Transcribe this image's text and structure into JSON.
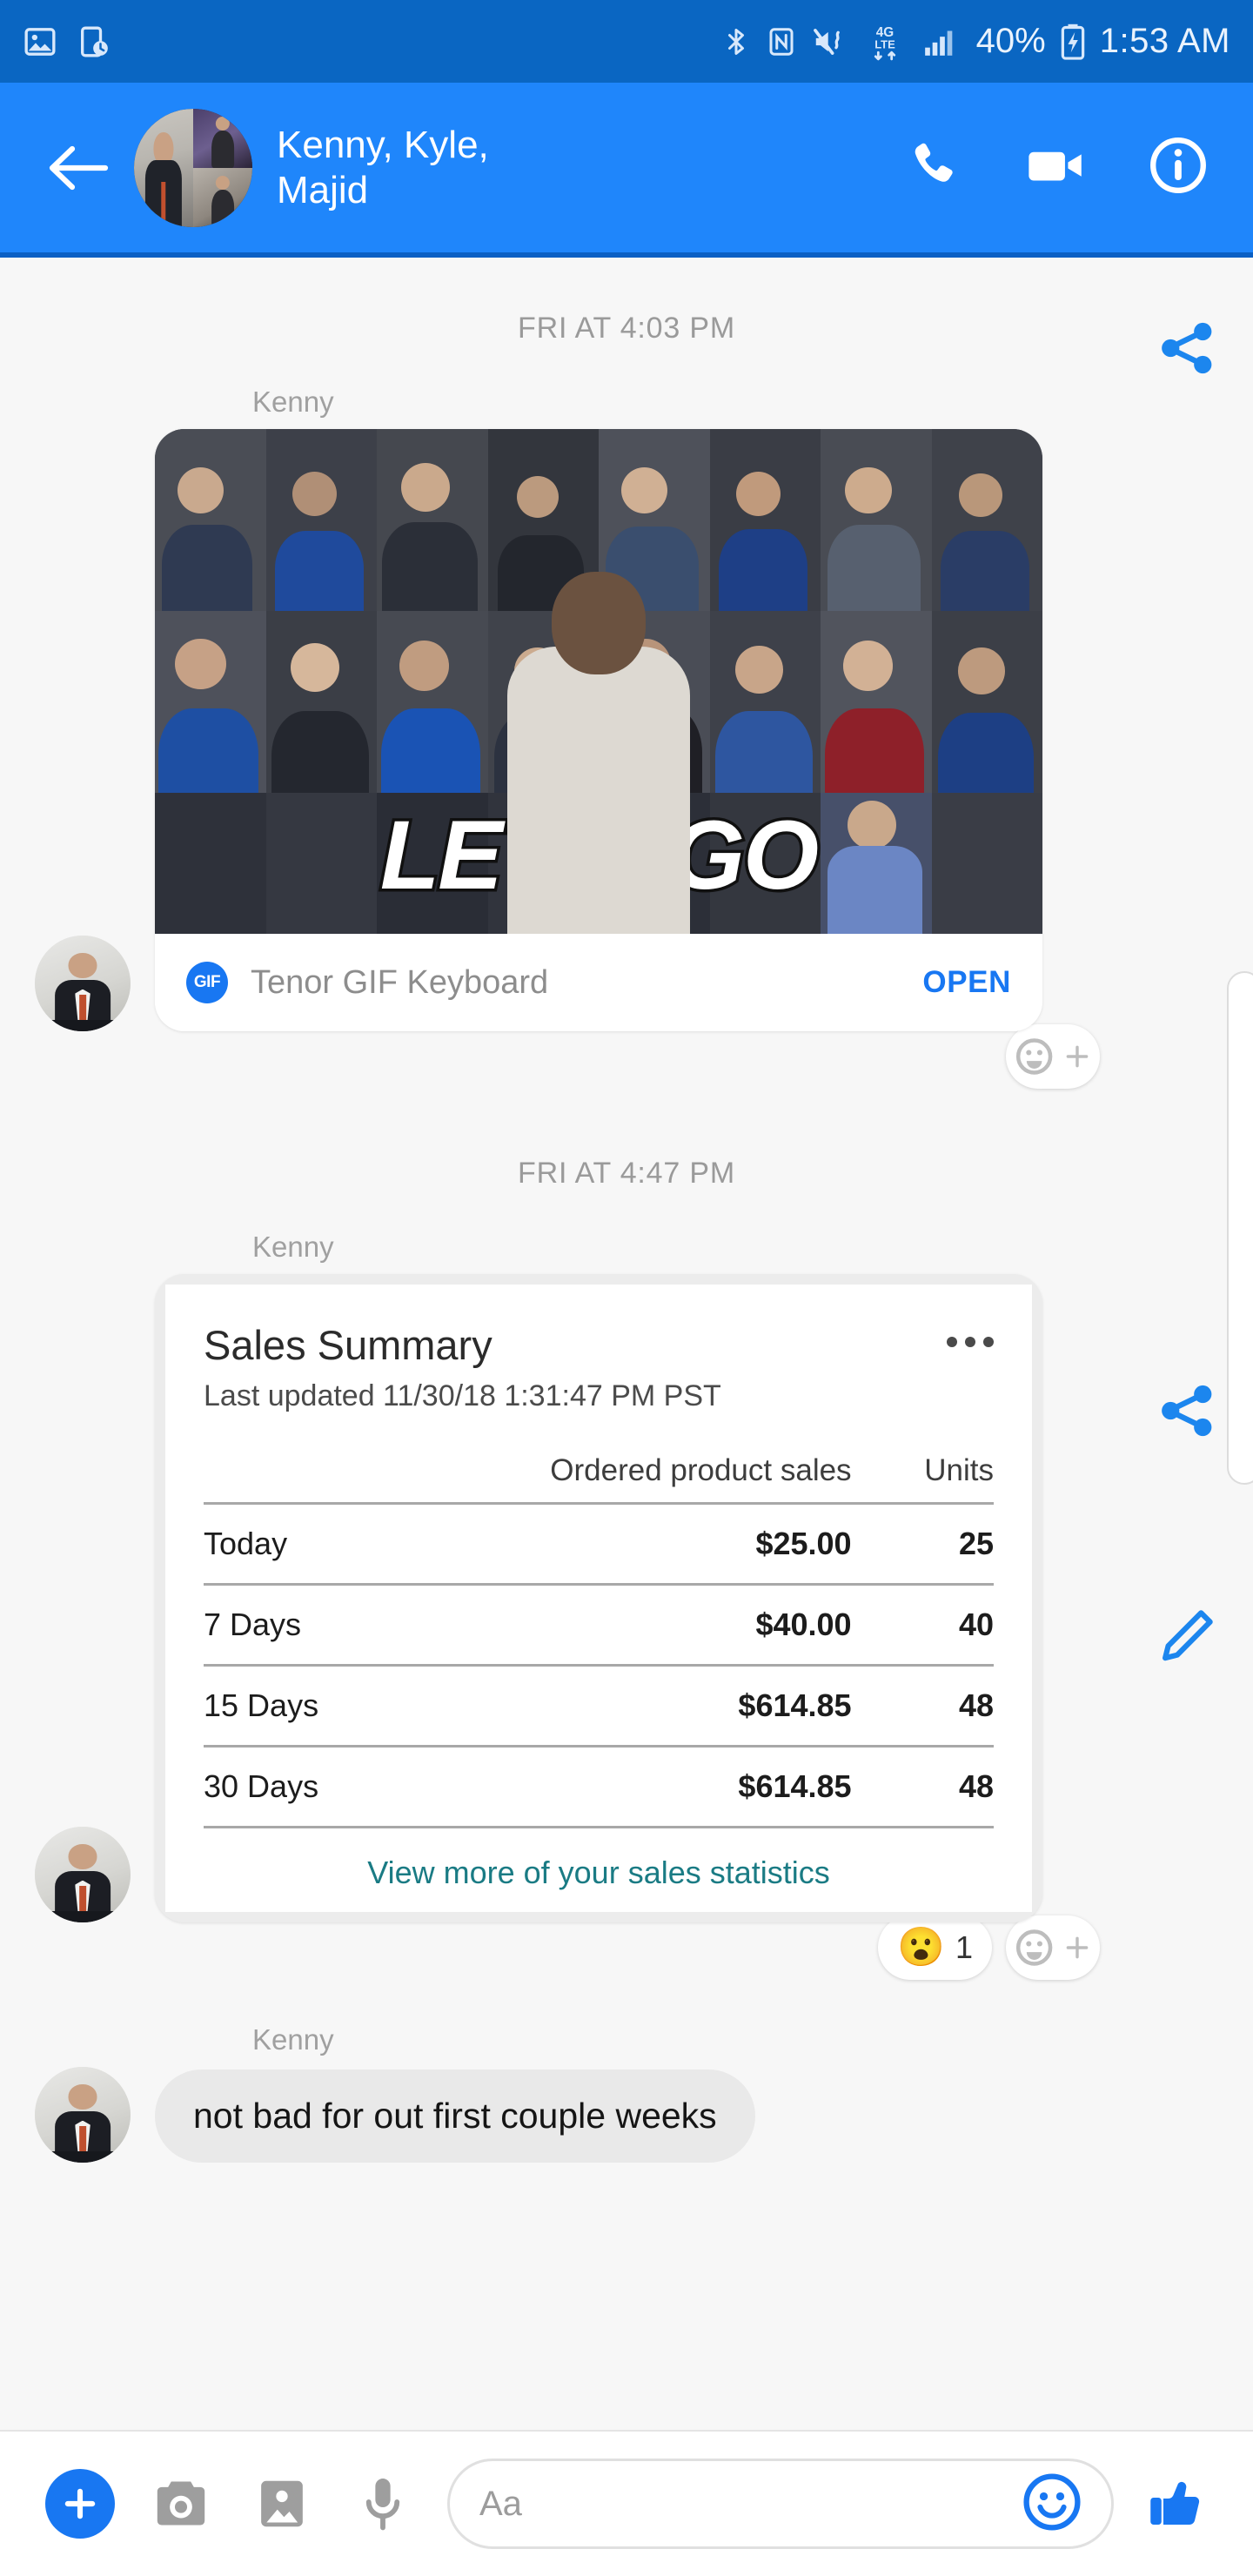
{
  "status_bar": {
    "left_icons": [
      "photo-icon",
      "screenshot-clock-icon"
    ],
    "right_icons": [
      "bluetooth-icon",
      "nfc-icon",
      "mute-vibrate-icon",
      "4g-lte-icon",
      "signal-bars-icon"
    ],
    "network_label": "4G\nLTE",
    "battery_percent": "40%",
    "time": "1:53 AM",
    "bg_color": "#0a66c2"
  },
  "header": {
    "back_icon": "back-arrow-icon",
    "title": "Kenny, Kyle, Majid",
    "call_icon": "phone-icon",
    "video_icon": "video-camera-icon",
    "info_icon": "info-circle-icon",
    "bg_color": "#1f86fb"
  },
  "conversation": {
    "groups": [
      {
        "timestamp": "FRI AT 4:03 PM",
        "sender": "Kenny",
        "type": "gif",
        "gif_caption": "LET'S GO",
        "attribution": {
          "badge": "GIF",
          "name": "Tenor GIF Keyboard",
          "action_label": "OPEN"
        },
        "side_action": "share-icon",
        "add_reaction_label": "add-reaction"
      },
      {
        "timestamp": "FRI AT 4:47 PM",
        "sender": "Kenny",
        "type": "card",
        "card": {
          "title": "Sales Summary",
          "subtitle": "Last updated 11/30/18 1:31:47 PM PST",
          "menu_icon": "more-options-icon",
          "columns": [
            "",
            "Ordered product sales",
            "Units"
          ],
          "rows": [
            {
              "label": "Today",
              "sales": "$25.00",
              "units": "25"
            },
            {
              "label": "7 Days",
              "sales": "$40.00",
              "units": "40"
            },
            {
              "label": "15 Days",
              "sales": "$614.85",
              "units": "48"
            },
            {
              "label": "30 Days",
              "sales": "$614.85",
              "units": "48"
            }
          ],
          "footer_link": "View more of your sales statistics",
          "link_color": "#1a7b84"
        },
        "side_actions": [
          "share-icon",
          "edit-pencil-icon"
        ],
        "reactions": [
          {
            "emoji": "😮",
            "count": "1"
          }
        ],
        "add_reaction_label": "add-reaction"
      },
      {
        "sender": "Kenny",
        "type": "text",
        "text": "not bad for out first couple weeks"
      }
    ]
  },
  "composer": {
    "plus_label": "open-actions",
    "camera_icon": "camera-icon",
    "gallery_icon": "gallery-icon",
    "mic_icon": "microphone-icon",
    "input_placeholder": "Aa",
    "emoji_icon": "emoji-smiley-icon",
    "thumb_icon": "thumbs-up-icon",
    "accent_color": "#1877f2"
  }
}
